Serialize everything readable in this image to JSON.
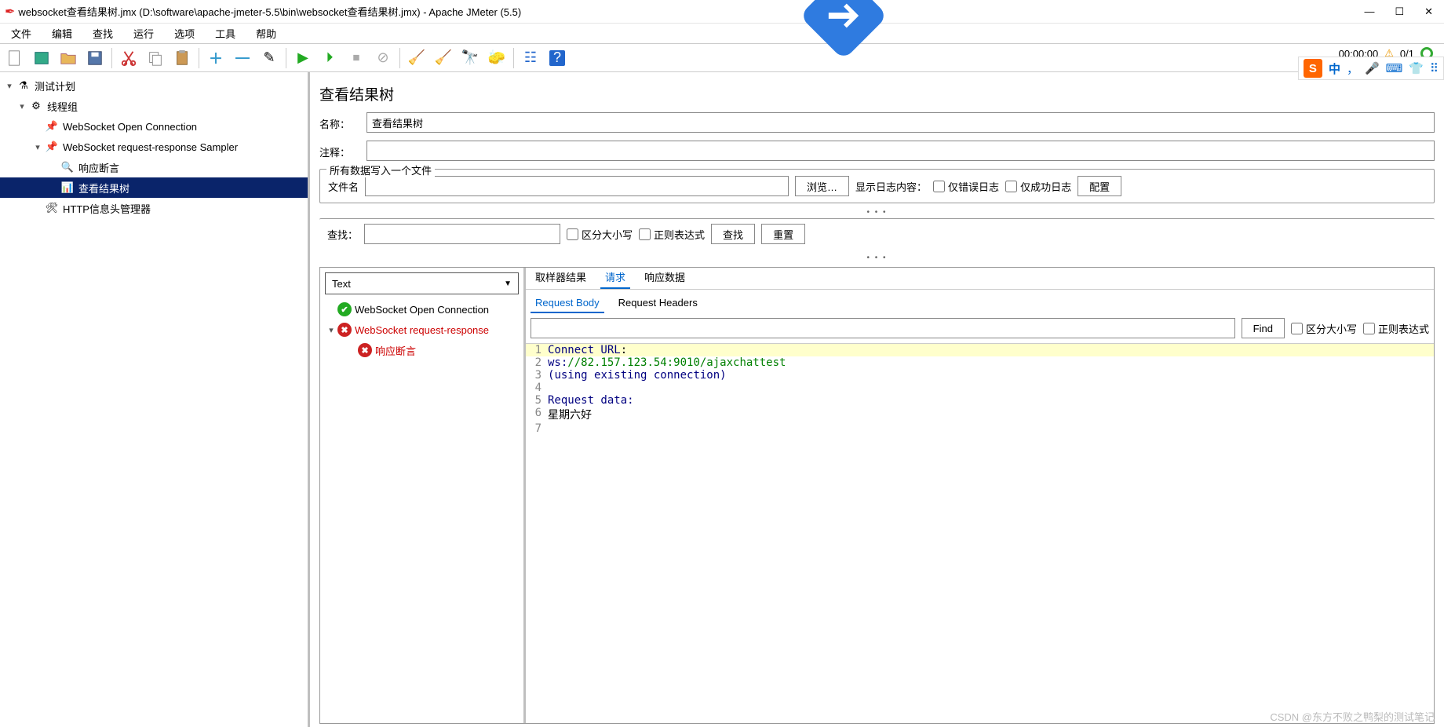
{
  "titlebar": {
    "title": "websocket查看结果树.jmx (D:\\software\\apache-jmeter-5.5\\bin\\websocket查看结果树.jmx) - Apache JMeter (5.5)"
  },
  "menu": [
    "文件",
    "编辑",
    "查找",
    "运行",
    "选项",
    "工具",
    "帮助"
  ],
  "timer": {
    "time": "00:00:00",
    "warn": "⚠",
    "threads": "0/1"
  },
  "ime": {
    "lang": "中",
    "items": [
      "，",
      "🎤",
      "⌨",
      "👕",
      "⠿"
    ]
  },
  "tree": {
    "plan": "测试计划",
    "group": "线程组",
    "n1": "WebSocket Open Connection",
    "n2": "WebSocket request-response Sampler",
    "n3": "响应断言",
    "n4": "查看结果树",
    "n5": "HTTP信息头管理器"
  },
  "page": {
    "title": "查看结果树",
    "name_label": "名称：",
    "name_value": "查看结果树",
    "comment_label": "注释：",
    "comment_value": "",
    "write_legend": "所有数据写入一个文件",
    "file_label": "文件名",
    "file_value": "",
    "browse": "浏览…",
    "showlog": "显示日志内容：",
    "err_only": "仅错误日志",
    "ok_only": "仅成功日志",
    "config": "配置",
    "search_label": "查找：",
    "search_value": "",
    "case": "区分大小写",
    "regex": "正则表达式",
    "search_btn": "查找",
    "reset_btn": "重置"
  },
  "results": {
    "type_select": "Text",
    "r1": "WebSocket Open Connection",
    "r2": "WebSocket request-response",
    "r3": "响应断言"
  },
  "detail": {
    "tabs": [
      "取样器结果",
      "请求",
      "响应数据"
    ],
    "subtabs": [
      "Request Body",
      "Request Headers"
    ],
    "find": "Find",
    "case": "区分大小写",
    "regex": "正则表达式",
    "find_value": ""
  },
  "code": {
    "l1a": "Connect URL",
    "l1b": ":",
    "l2a": "ws:",
    "l2b": "//82.157.123.54:9010/ajaxchattest",
    "l3a": "(",
    "l3b": "using existing connection",
    "l3c": ")",
    "l5": "Request data:",
    "l6": "星期六好"
  },
  "watermark": "CSDN @东方不败之鸭梨的测试笔记"
}
